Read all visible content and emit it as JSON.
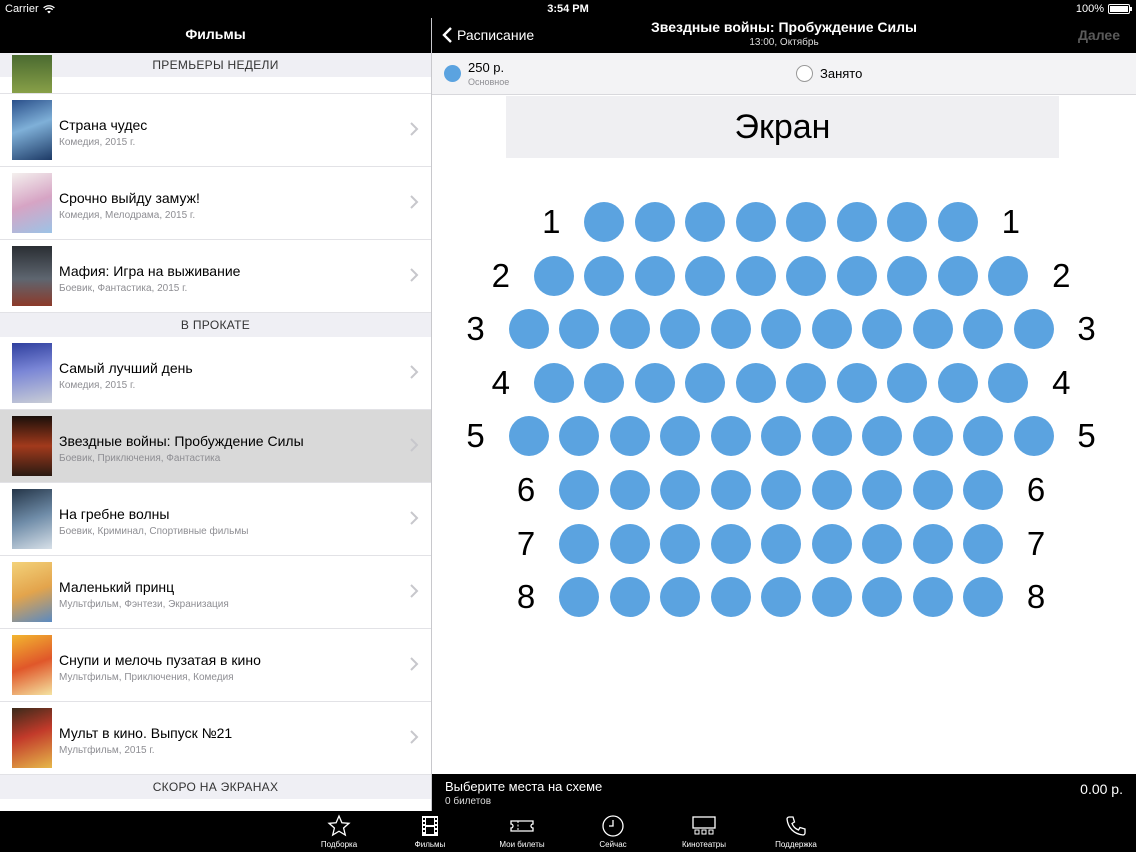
{
  "status_bar": {
    "carrier": "Carrier",
    "time": "3:54 PM",
    "battery": "100%"
  },
  "left_pane": {
    "title": "Фильмы",
    "sections": [
      {
        "header": "ПРЕМЬЕРЫ НЕДЕЛИ",
        "items": [
          {
            "title": "Страна чудес",
            "subtitle": "Комедия, 2015 г."
          },
          {
            "title": "Срочно выйду замуж!",
            "subtitle": "Комедия, Мелодрама, 2015 г."
          },
          {
            "title": "Мафия: Игра на выживание",
            "subtitle": "Боевик, Фантастика, 2015 г."
          }
        ]
      },
      {
        "header": "В ПРОКАТЕ",
        "items": [
          {
            "title": "Самый лучший день",
            "subtitle": "Комедия, 2015 г."
          },
          {
            "title": "Звездные войны: Пробуждение Силы",
            "subtitle": "Боевик, Приключения, Фантастика",
            "selected": true
          },
          {
            "title": "На гребне волны",
            "subtitle": "Боевик, Криминал, Спортивные фильмы"
          },
          {
            "title": "Маленький принц",
            "subtitle": "Мультфильм, Фэнтези, Экранизация"
          },
          {
            "title": "Снупи и мелочь пузатая в кино",
            "subtitle": "Мультфильм, Приключения, Комедия"
          },
          {
            "title": "Мульт в кино. Выпуск №21",
            "subtitle": "Мультфильм, 2015 г."
          }
        ]
      },
      {
        "header": "СКОРО НА ЭКРАНАХ",
        "items": []
      }
    ]
  },
  "right_pane": {
    "back_label": "Расписание",
    "title": "Звездные войны: Пробуждение Силы",
    "subtitle": "13:00, Октябрь",
    "next_label": "Далее",
    "legend": {
      "price": "250 р.",
      "price_type": "Основное",
      "occupied": "Занято"
    },
    "screen_label": "Экран",
    "seat_rows": [
      {
        "label": "1",
        "seats": 8
      },
      {
        "label": "2",
        "seats": 10
      },
      {
        "label": "3",
        "seats": 11
      },
      {
        "label": "4",
        "seats": 10
      },
      {
        "label": "5",
        "seats": 11
      },
      {
        "label": "6",
        "seats": 9
      },
      {
        "label": "7",
        "seats": 9
      },
      {
        "label": "8",
        "seats": 9
      }
    ],
    "bottom": {
      "prompt": "Выберите места на схеме",
      "count": "0 билетов",
      "total": "0.00 р."
    }
  },
  "tab_bar": [
    {
      "label": "Подборка",
      "icon": "star-icon"
    },
    {
      "label": "Фильмы",
      "icon": "film-icon"
    },
    {
      "label": "Мои билеты",
      "icon": "ticket-icon"
    },
    {
      "label": "Сейчас",
      "icon": "clock-icon"
    },
    {
      "label": "Кинотеатры",
      "icon": "cinema-icon"
    },
    {
      "label": "Поддержка",
      "icon": "phone-icon"
    }
  ],
  "colors": {
    "seat_available": "#5ba3e0",
    "selected_row": "#d9d9d9"
  }
}
